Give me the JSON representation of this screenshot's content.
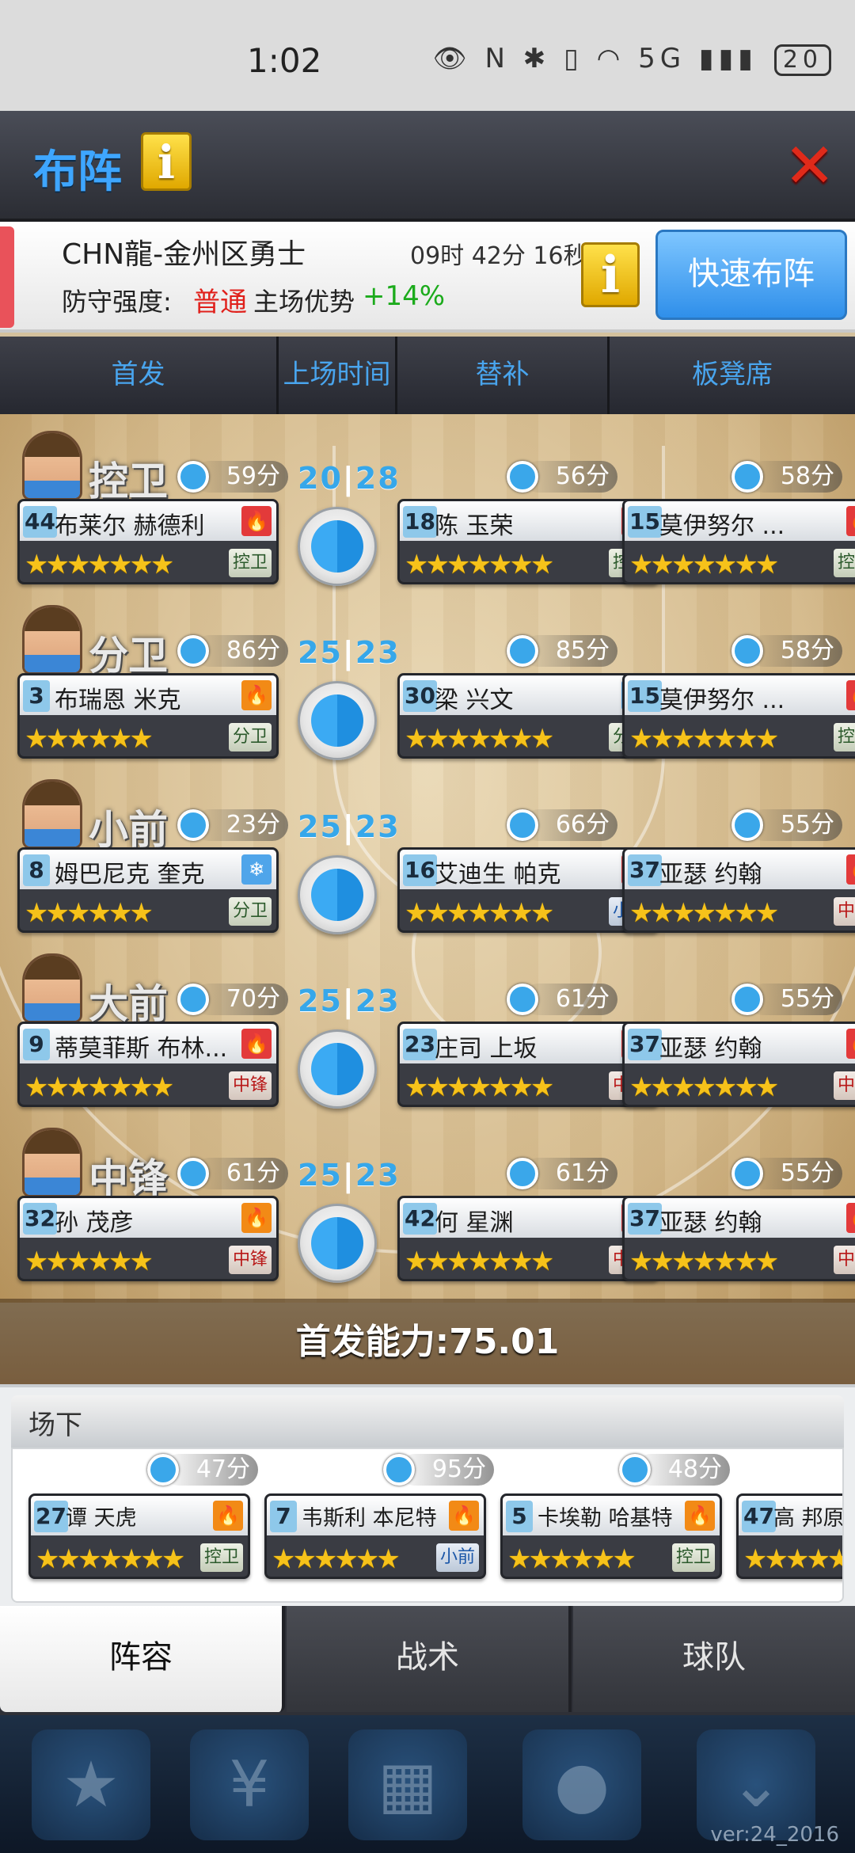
{
  "status_bar": {
    "time": "1:02",
    "icons": "👁 N ✱ ▯ ◠ 5G ▮▮▮",
    "battery": "20"
  },
  "header": {
    "title": "布阵",
    "info_label": "i",
    "close_label": "✕"
  },
  "team": {
    "name": "CHN龍-金州区勇士",
    "timer": "09时 42分 16秒",
    "defense_label": "防守强度:",
    "defense_value": "普通",
    "home_label": "主场优势",
    "home_value": "+14%",
    "info_label": "i",
    "quick_button": "快速布阵"
  },
  "tabs": [
    "首发",
    "上场时间",
    "替补",
    "板凳席"
  ],
  "rows": [
    {
      "position": "控卫",
      "minutes": "59分",
      "ratio_a": "20",
      "ratio_b": "28",
      "starter": {
        "num": "44",
        "name": "布莱尔 赫德利",
        "badge": "fire",
        "badge_icon": "🔥",
        "stars": "★★★★★★★",
        "pos": "控卫",
        "pos_color": "green"
      },
      "sub1": {
        "minutes": "56分",
        "num": "18",
        "name": "陈 玉荣",
        "badge": "fire",
        "badge_icon": "🔥",
        "stars": "★★★★★★★",
        "pos": "控卫",
        "pos_color": "green"
      },
      "sub2": {
        "minutes": "58分",
        "num": "15",
        "name": "莫伊努尔 ...",
        "badge": "fire",
        "badge_icon": "🔥",
        "stars": "★★★★★★★",
        "pos": "控卫",
        "pos_color": "green"
      }
    },
    {
      "position": "分卫",
      "minutes": "86分",
      "ratio_a": "25",
      "ratio_b": "23",
      "starter": {
        "num": "3",
        "name": "布瑞恩 米克",
        "badge": "flame",
        "badge_icon": "🔥",
        "stars": "★★★★★★",
        "pos": "分卫",
        "pos_color": "green"
      },
      "sub1": {
        "minutes": "85分",
        "num": "30",
        "name": "梁 兴文",
        "badge": "ice",
        "badge_icon": "❄",
        "stars": "★★★★★★★",
        "pos": "分卫",
        "pos_color": "green"
      },
      "sub2": {
        "minutes": "58分",
        "num": "15",
        "name": "莫伊努尔 ...",
        "badge": "fire",
        "badge_icon": "🔥",
        "stars": "★★★★★★★",
        "pos": "控卫",
        "pos_color": "green"
      }
    },
    {
      "position": "小前",
      "minutes": "23分",
      "ratio_a": "25",
      "ratio_b": "23",
      "starter": {
        "num": "8",
        "name": "姆巴尼克 奎克",
        "badge": "ice",
        "badge_icon": "❄",
        "stars": "★★★★★★",
        "pos": "分卫",
        "pos_color": "green"
      },
      "sub1": {
        "minutes": "66分",
        "num": "16",
        "name": "艾迪生 帕克",
        "badge": "fire",
        "badge_icon": "🔥",
        "stars": "★★★★★★★",
        "pos": "小前",
        "pos_color": "blue"
      },
      "sub2": {
        "minutes": "55分",
        "num": "37",
        "name": "亚瑟 约翰",
        "badge": "fire",
        "badge_icon": "🔥",
        "stars": "★★★★★★★",
        "pos": "中锋",
        "pos_color": "red"
      }
    },
    {
      "position": "大前",
      "minutes": "70分",
      "ratio_a": "25",
      "ratio_b": "23",
      "starter": {
        "num": "9",
        "name": "蒂莫菲斯 布林...",
        "badge": "fire",
        "badge_icon": "🔥",
        "stars": "★★★★★★★",
        "pos": "中锋",
        "pos_color": "red"
      },
      "sub1": {
        "minutes": "61分",
        "num": "23",
        "name": "庄司 上坂",
        "badge": "fire",
        "badge_icon": "🔥",
        "stars": "★★★★★★★",
        "pos": "中锋",
        "pos_color": "red"
      },
      "sub2": {
        "minutes": "55分",
        "num": "37",
        "name": "亚瑟 约翰",
        "badge": "fire",
        "badge_icon": "🔥",
        "stars": "★★★★★★★",
        "pos": "中锋",
        "pos_color": "red"
      }
    },
    {
      "position": "中锋",
      "minutes": "61分",
      "ratio_a": "25",
      "ratio_b": "23",
      "starter": {
        "num": "32",
        "name": "孙 茂彦",
        "badge": "flame",
        "badge_icon": "🔥",
        "stars": "★★★★★★",
        "pos": "中锋",
        "pos_color": "red"
      },
      "sub1": {
        "minutes": "61分",
        "num": "42",
        "name": "何 星渊",
        "badge": "fire",
        "badge_icon": "🔥",
        "stars": "★★★★★★★",
        "pos": "中锋",
        "pos_color": "red"
      },
      "sub2": {
        "minutes": "55分",
        "num": "37",
        "name": "亚瑟 约翰",
        "badge": "fire",
        "badge_icon": "🔥",
        "stars": "★★★★★★★",
        "pos": "中锋",
        "pos_color": "red"
      }
    }
  ],
  "starting_power": "首发能力:75.01",
  "bench": {
    "title": "场下",
    "players": [
      {
        "minutes": "47分",
        "num": "27",
        "name": "谭 天虎",
        "badge": "flame",
        "badge_icon": "🔥",
        "stars": "★★★★★★★",
        "pos": "控卫",
        "pos_color": "green"
      },
      {
        "minutes": "95分",
        "num": "7",
        "name": "韦斯利 本尼特",
        "badge": "flame",
        "badge_icon": "🔥",
        "stars": "★★★★★★",
        "pos": "小前",
        "pos_color": "blue"
      },
      {
        "minutes": "48分",
        "num": "5",
        "name": "卡埃勒 哈基特",
        "badge": "flame",
        "badge_icon": "🔥",
        "stars": "★★★★★★",
        "pos": "控卫",
        "pos_color": "green"
      },
      {
        "minutes": "",
        "num": "47",
        "name": "高 邦原",
        "badge": "",
        "badge_icon": "",
        "stars": "★★★★★",
        "pos": "",
        "pos_color": "green"
      }
    ]
  },
  "bottom_tabs": [
    "阵容",
    "战术",
    "球队"
  ],
  "nav_icons": [
    "★",
    "¥",
    "▦",
    "●",
    "⌄"
  ],
  "version": "ver:24_2016"
}
